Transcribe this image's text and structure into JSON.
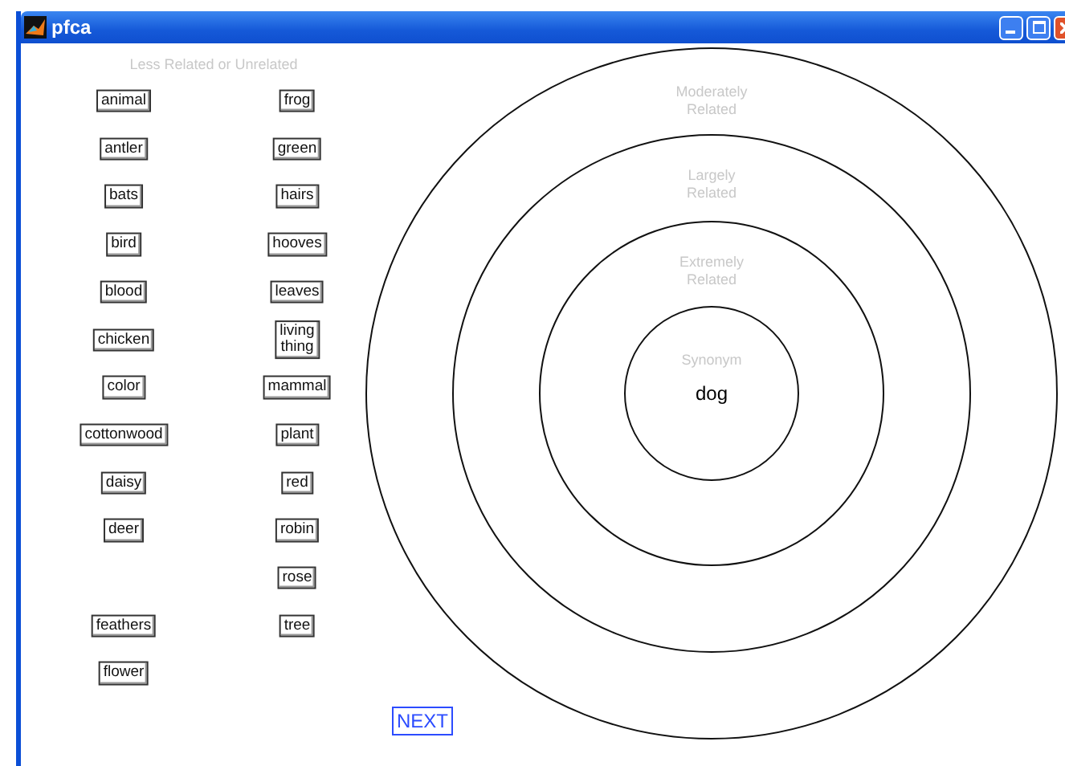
{
  "window": {
    "title": "pfca"
  },
  "heading": "Less Related or Unrelated",
  "words": [
    {
      "text": "animal",
      "placed": false
    },
    {
      "text": "antler",
      "placed": false
    },
    {
      "text": "bats",
      "placed": false
    },
    {
      "text": "bird",
      "placed": false
    },
    {
      "text": "blood",
      "placed": false
    },
    {
      "text": "chicken",
      "placed": false
    },
    {
      "text": "color",
      "placed": false
    },
    {
      "text": "cottonwood",
      "placed": false
    },
    {
      "text": "daisy",
      "placed": false
    },
    {
      "text": "deer",
      "placed": false
    },
    {
      "text": "dog",
      "placed": true
    },
    {
      "text": "feathers",
      "placed": false
    },
    {
      "text": "flower",
      "placed": false
    },
    {
      "text": "frog",
      "placed": false
    },
    {
      "text": "green",
      "placed": false
    },
    {
      "text": "hairs",
      "placed": false
    },
    {
      "text": "hooves",
      "placed": false
    },
    {
      "text": "leaves",
      "placed": false
    },
    {
      "text": "living\nthing",
      "placed": false
    },
    {
      "text": "mammal",
      "placed": false
    },
    {
      "text": "plant",
      "placed": false
    },
    {
      "text": "red",
      "placed": false
    },
    {
      "text": "robin",
      "placed": false
    },
    {
      "text": "rose",
      "placed": false
    },
    {
      "text": "tree",
      "placed": false
    }
  ],
  "rings": [
    {
      "label": "Moderately\nRelated"
    },
    {
      "label": "Largely\nRelated"
    },
    {
      "label": "Extremely\nRelated"
    },
    {
      "label": "Synonym"
    }
  ],
  "next_button": "NEXT"
}
